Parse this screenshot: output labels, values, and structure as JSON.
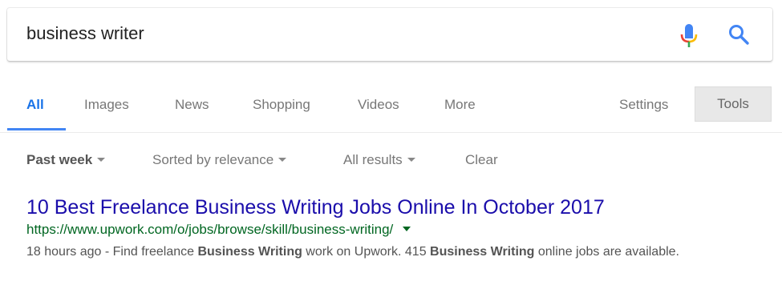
{
  "search": {
    "query": "business writer",
    "mic_icon": "microphone-icon",
    "search_icon": "magnifier-icon"
  },
  "tabs": {
    "items": [
      "All",
      "Images",
      "News",
      "Shopping",
      "Videos",
      "More"
    ],
    "active": "All",
    "settings_label": "Settings",
    "tools_label": "Tools"
  },
  "filters": {
    "time": "Past week",
    "sort": "Sorted by relevance",
    "results": "All results",
    "clear": "Clear"
  },
  "result": {
    "title": "10 Best Freelance Business Writing Jobs Online In October 2017",
    "url": "https://www.upwork.com/o/jobs/browse/skill/business-writing/",
    "snippet": {
      "date": "18 hours ago",
      "separator": " - ",
      "part1": "Find freelance ",
      "bold1": "Business Writing",
      "part2": " work on Upwork. 415 ",
      "bold2": "Business Writing",
      "part3": " online jobs are available."
    }
  },
  "colors": {
    "link": "#1a0dab",
    "url": "#006621",
    "active_tab": "#1a73e8",
    "underline": "#4285f4"
  }
}
